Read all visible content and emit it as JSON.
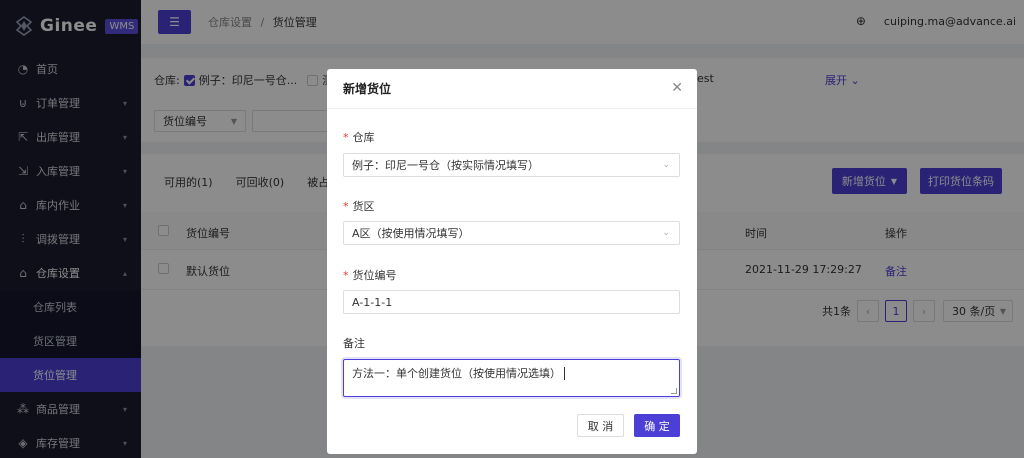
{
  "brand": {
    "name": "Ginee",
    "badge": "WMS"
  },
  "sidebar": {
    "items": [
      {
        "label": "首页",
        "icon": "dashboard-icon"
      },
      {
        "label": "订单管理",
        "icon": "cart-icon"
      },
      {
        "label": "出库管理",
        "icon": "outbound-icon"
      },
      {
        "label": "入库管理",
        "icon": "inbound-icon"
      },
      {
        "label": "库内作业",
        "icon": "warehouse-icon"
      },
      {
        "label": "调拨管理",
        "icon": "transfer-icon"
      },
      {
        "label": "仓库设置",
        "icon": "settings-icon"
      }
    ],
    "subitems": [
      {
        "label": "仓库列表"
      },
      {
        "label": "货区管理"
      },
      {
        "label": "货位管理"
      }
    ],
    "items_after": [
      {
        "label": "商品管理",
        "icon": "product-icon"
      },
      {
        "label": "库存管理",
        "icon": "inventory-icon"
      }
    ]
  },
  "topbar": {
    "breadcrumb_parent": "仓库设置",
    "breadcrumb_sep": "/",
    "breadcrumb_current": "货位管理",
    "user": "cuiping.ma@advance.ai"
  },
  "filter": {
    "warehouse_label": "仓库:",
    "warehouse_option": "例子：印尼一号仓...",
    "option_partial": "测",
    "option_tail": "est",
    "expand": "展开",
    "location_select": "货位编号"
  },
  "list": {
    "tabs": [
      "可用的(1)",
      "可回收(0)",
      "被占用"
    ],
    "add_button": "新增货位",
    "print_button": "打印货位条码",
    "columns": {
      "code": "货位编号",
      "time": "时间",
      "action": "操作"
    },
    "rows": [
      {
        "code": "默认货位",
        "time": "2021-11-29 17:29:27",
        "action": "备注"
      }
    ],
    "total": "共1条",
    "current_page": "1",
    "page_size": "30 条/页"
  },
  "modal": {
    "title": "新增货位",
    "warehouse_label": "仓库",
    "warehouse_value": "例子：印尼一号仓（按实际情况填写）",
    "zone_label": "货区",
    "zone_value": "A区（按使用情况填写）",
    "code_label": "货位编号",
    "code_value": "A-1-1-1",
    "remark_label": "备注",
    "remark_value": "方法一：单个创建货位（按使用情况选填）",
    "cancel": "取 消",
    "confirm": "确 定"
  }
}
